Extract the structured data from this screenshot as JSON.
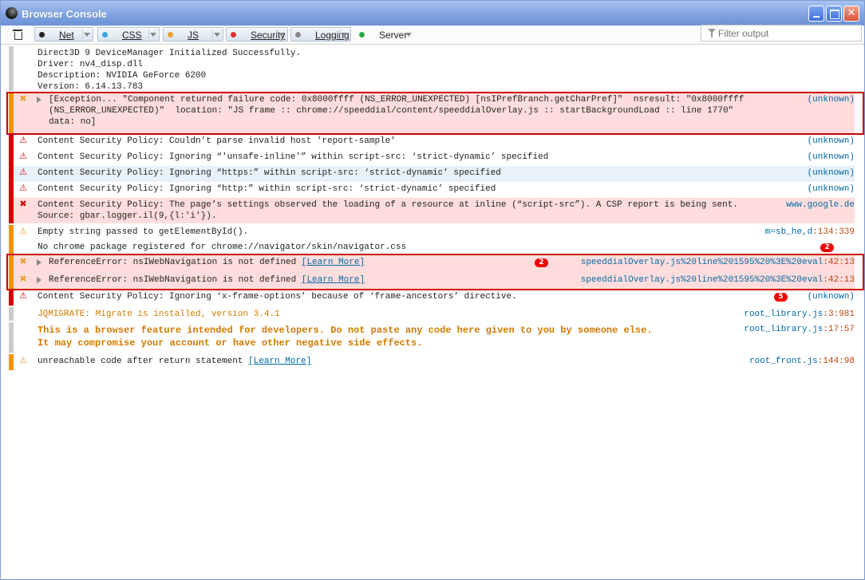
{
  "window": {
    "title": "Browser Console"
  },
  "titlebar_buttons": {
    "minimize": "minimize",
    "maximize": "maximize",
    "close": "close"
  },
  "toolbar": {
    "filters": [
      {
        "label": "Net",
        "color": "#222222"
      },
      {
        "label": "CSS",
        "color": "#3aa3e3"
      },
      {
        "label": "JS",
        "color": "#e8a030"
      },
      {
        "label": "Security",
        "color": "#e03030"
      },
      {
        "label": "Logging",
        "color": "#8a8a8a"
      },
      {
        "label": "Server",
        "color": "#2ea84a"
      }
    ],
    "filter_placeholder": "Filter output"
  },
  "messages": [
    {
      "category": "logging",
      "severity": "log",
      "lines": [
        "Direct3D 9 DeviceManager Initialized Successfully.",
        "Driver: nv4_disp.dll",
        "Description: NVIDIA GeForce 6200",
        "Version: 6.14.13.783"
      ],
      "source": ""
    },
    {
      "category": "js",
      "severity": "error",
      "expandable": true,
      "lines": [
        "[Exception... \"Component returned failure code: 0x8000ffff (NS_ERROR_UNEXPECTED) [nsIPrefBranch.getCharPref]\"  nsresult: \"0x8000ffff",
        "(NS_ERROR_UNEXPECTED)\"  location: \"JS frame :: chrome://speeddial/content/speeddialOverlay.js :: startBackgroundLoad :: line 1770\"",
        "data: no]"
      ],
      "source": "(unknown)"
    },
    {
      "category": "security",
      "severity": "warning",
      "lines": [
        "Content Security Policy: Couldn’t parse invalid host 'report-sample'"
      ],
      "source": "(unknown)"
    },
    {
      "category": "security",
      "severity": "warning",
      "lines": [
        "Content Security Policy: Ignoring “'unsafe-inline'” within script-src: ‘strict-dynamic’ specified"
      ],
      "source": "(unknown)"
    },
    {
      "category": "security",
      "severity": "warning",
      "lines": [
        "Content Security Policy: Ignoring “https:” within script-src: ‘strict-dynamic’ specified"
      ],
      "source": "(unknown)"
    },
    {
      "category": "security",
      "severity": "warning",
      "lines": [
        "Content Security Policy: Ignoring “http:” within script-src: ‘strict-dynamic’ specified"
      ],
      "source": "(unknown)"
    },
    {
      "category": "security",
      "severity": "error",
      "lines": [
        "Content Security Policy: The page’s settings observed the loading of a resource at inline (“script-src”). A CSP report is being sent.",
        "Source: gbar.logger.il(9,{l:'i'})."
      ],
      "source": "www.google.de"
    },
    {
      "category": "js",
      "severity": "warning",
      "lines": [
        "Empty string passed to getElementById()."
      ],
      "source": "m=sb_he,d",
      "location": ":134:339"
    },
    {
      "category": "js",
      "severity": "log",
      "lines": [
        "No chrome package registered for chrome://navigator/skin/navigator.css"
      ],
      "source": "",
      "count": "2"
    },
    {
      "category": "js",
      "severity": "error",
      "expandable": true,
      "lines": [
        "ReferenceError: nsIWebNavigation is not defined "
      ],
      "learn_more": "[Learn More]",
      "source": "speeddialOverlay.js%20line%201595%20%3E%20eval",
      "location": ":42:13",
      "count": "2"
    },
    {
      "category": "js",
      "severity": "error",
      "expandable": true,
      "lines": [
        "ReferenceError: nsIWebNavigation is not defined "
      ],
      "learn_more": "[Learn More]",
      "source": "speeddialOverlay.js%20line%201595%20%3E%20eval",
      "location": ":42:13"
    },
    {
      "category": "security",
      "severity": "warning",
      "lines": [
        "Content Security Policy: Ignoring ‘x-frame-options’ because of ‘frame-ancestors’ directive."
      ],
      "source": "(unknown)",
      "count": "5"
    },
    {
      "category": "logging",
      "severity": "log",
      "lines": [
        "JQMIGRATE: Migrate is installed, version 3.4.1"
      ],
      "source": "root_library.js",
      "location": ":3:981"
    },
    {
      "category": "logging",
      "severity": "log",
      "lines": [
        "This is a browser feature intended for developers. Do not paste any code here given to you by someone else.",
        "It may compromise your account or have other negative side effects."
      ],
      "source": "root_library.js",
      "location": ":17:57"
    },
    {
      "category": "js",
      "severity": "warning",
      "lines": [
        "unreachable code after return statement "
      ],
      "learn_more": "[Learn More]",
      "source": "root_front.js",
      "location": ":144:98"
    }
  ],
  "colors": {
    "js": "#f29400",
    "security": "#d00000",
    "logging": "#cccccc",
    "error_bg": "#ffdddd",
    "highlight_outline": "#cc0000"
  }
}
